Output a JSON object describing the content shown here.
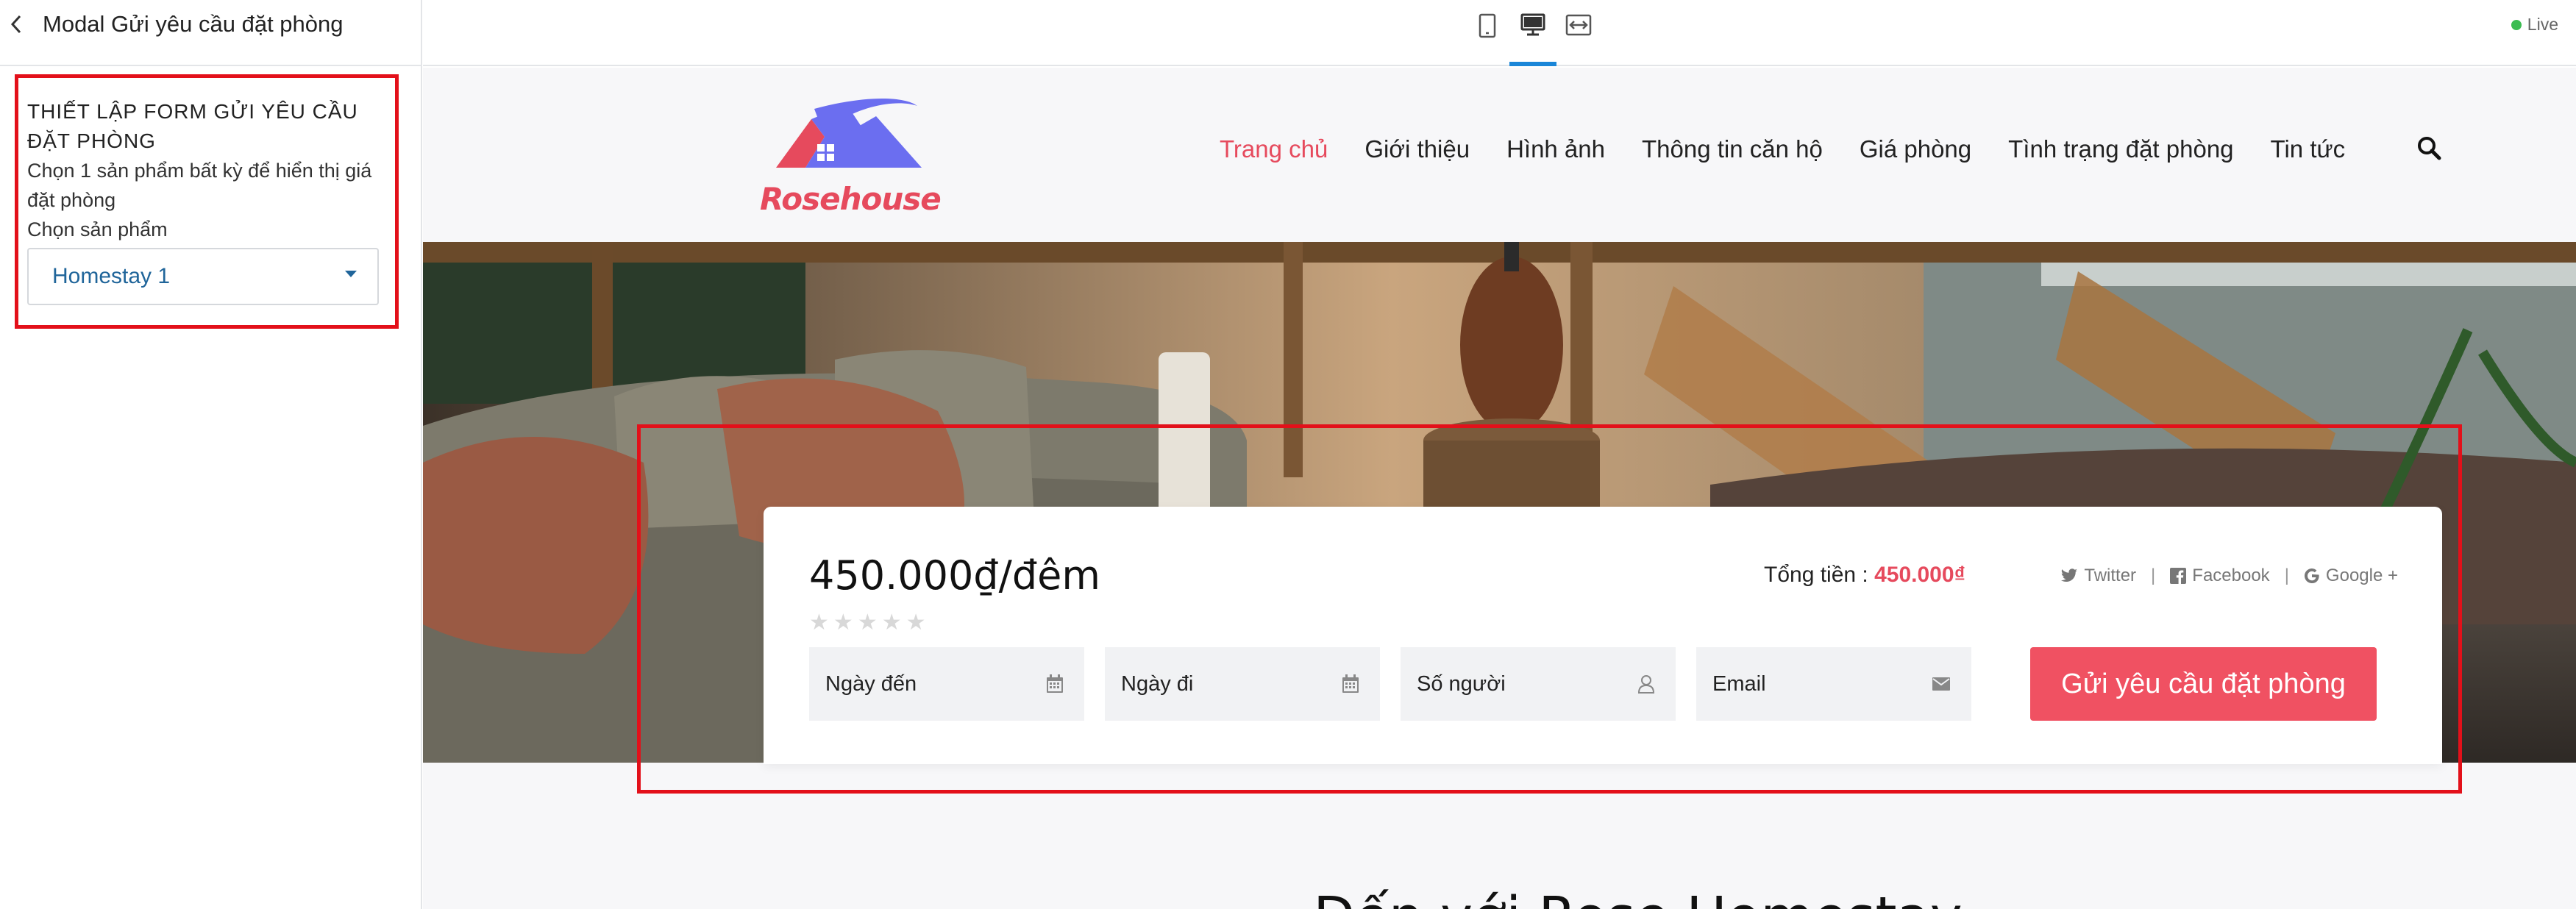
{
  "panel": {
    "title": "Modal Gửi yêu cầu đặt phòng",
    "heading": "THIẾT LẬP FORM GỬI YÊU CẦU ĐẶT PHÒNG",
    "help_text": "Chọn 1 sản phẩm bất kỳ để hiển thị giá đặt phòng",
    "select_label": "Chọn sản phẩm",
    "selected_product": "Homestay 1"
  },
  "topbar": {
    "devices": [
      "mobile-icon",
      "desktop-icon",
      "fullwidth-icon"
    ],
    "active_device": "desktop",
    "live_label": "Live",
    "accent_color": "#1a86d8",
    "live_color": "#3cbc52"
  },
  "site": {
    "logo_text": "Rosehouse",
    "nav": [
      "Trang chủ",
      "Giới thiệu",
      "Hình ảnh",
      "Thông tin căn hộ",
      "Giá phòng",
      "Tình trạng đặt phòng",
      "Tin tức"
    ],
    "active_nav": "Trang chủ",
    "brand_color": "#e64a5d"
  },
  "booking": {
    "price": "450.000₫/đêm",
    "rating_stars": 0,
    "total_label": "Tổng tiền :",
    "total_value": "450.000₫",
    "social": {
      "twitter": "Twitter",
      "facebook": "Facebook",
      "google": "Google +"
    },
    "fields": [
      {
        "label": "Ngày đến",
        "icon": "calendar-icon"
      },
      {
        "label": "Ngày đi",
        "icon": "calendar-icon"
      },
      {
        "label": "Số người",
        "icon": "user-icon"
      },
      {
        "label": "Email",
        "icon": "envelope-icon"
      }
    ],
    "submit_label": "Gửi yêu cầu đặt phòng",
    "button_color": "#f05162"
  },
  "section": {
    "title": "Đến với Rose Homestay"
  }
}
